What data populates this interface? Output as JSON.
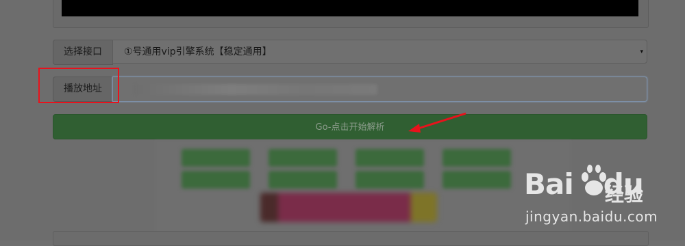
{
  "player": {},
  "interface_row": {
    "label": "选择接口",
    "selected": "①号通用vip引擎系统【稳定通用】",
    "caret": "▾"
  },
  "url_row": {
    "label": "播放地址",
    "value": ""
  },
  "go_button": {
    "label": "Go-点击开始解析",
    "color": "#305f32"
  },
  "annotations": {
    "highlight_color": "#e8121c"
  },
  "watermark": {
    "logo_left": "Bai",
    "logo_right": "du",
    "product": "经验",
    "url": "jingyan.baidu.com"
  }
}
